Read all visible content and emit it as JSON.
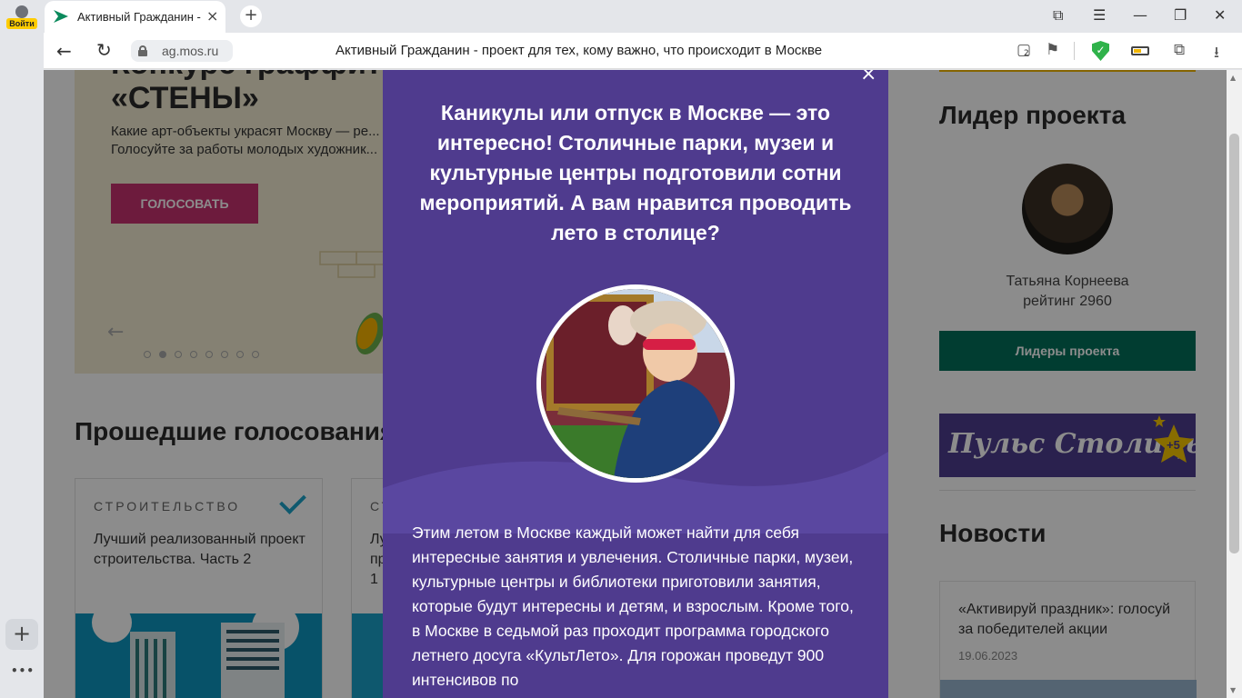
{
  "browser": {
    "login_label": "Войти",
    "tab_title": "Активный Гражданин - проект для тех, кому важно, что происходит в Москве",
    "url": "ag.mos.ru",
    "page_title": "Активный Гражданин - проект для тех, кому важно, что происходит в Москве",
    "tab_count": "2",
    "icons": {
      "new_tab": "plus-icon",
      "back": "arrow-left-icon",
      "reload": "reload-icon",
      "lock": "lock-icon",
      "bookmark": "bookmark-icon",
      "protect": "shield-icon",
      "battery": "battery-icon",
      "extensions": "extensions-icon",
      "download": "download-icon",
      "bookmarks_panel": "bookmarks-panel-icon",
      "menu": "hamburger-icon",
      "minimize": "minimize-icon",
      "restore": "restore-icon",
      "close": "close-icon"
    },
    "accent_color": "#ffcc00"
  },
  "page": {
    "hero": {
      "title_line1": "Конкурс граффити",
      "title_line2": "«СТЕНЫ»",
      "text": "Какие арт-объекты украсят Москву — ре... Голосуйте за работы молодых художник...",
      "vote_button": "ГОЛОСОВАТЬ",
      "button_color": "#c7326f"
    },
    "past_votes": {
      "title": "Прошедшие голосования",
      "cards": [
        {
          "category": "СТРОИТЕЛЬСТВО",
          "title": "Лучший реализованный проект строительства. Часть 2"
        },
        {
          "category": "СТ",
          "title": "Лу пр 1"
        }
      ]
    },
    "leader": {
      "title": "Лидер проекта",
      "name": "Татьяна Корнеева",
      "rating": "рейтинг 2960",
      "button": "Лидеры проекта",
      "button_color": "#02705a"
    },
    "banner": {
      "text": "Пульс Столицы",
      "badge": "+5"
    },
    "news": {
      "title": "Новости",
      "items": [
        {
          "title": "«Активируй праздник»: голосуй за победителей акции",
          "date": "19.06.2023"
        }
      ]
    }
  },
  "modal": {
    "heading": "Каникулы или отпуск в Москве — это интересно! Столичные парки, музеи и культурные центры подготовили сотни мероприятий. А вам нравится проводить лето в столице?",
    "body": "Этим летом в Москве каждый может найти для себя интересные занятия и увлечения. Столичные парки, музеи, культурные центры и библиотеки приготовили занятия, которые будут интересны и детям, и взрослым. Кроме того, в Москве в седьмой раз проходит программа городского летнего досуга «КультЛето». Для горожан проведут 900 интенсивов по",
    "close_symbol": "×",
    "background_color": "#4f3b8e"
  }
}
